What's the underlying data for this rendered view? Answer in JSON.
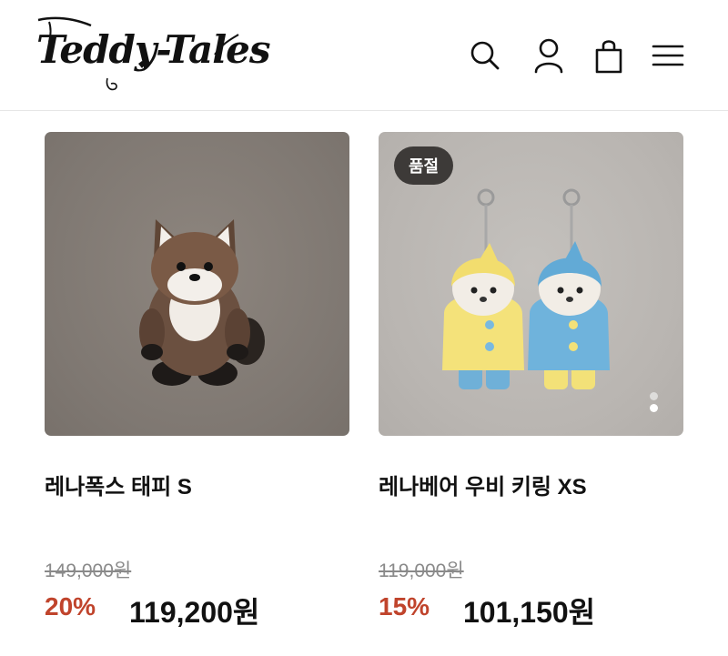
{
  "header": {
    "logo_text": "Teddy-Tales",
    "icons": [
      "search-icon",
      "user-icon",
      "shopping-bag-icon",
      "menu-icon"
    ]
  },
  "products": [
    {
      "name": "레나폭스 태피 S",
      "original_price": "149,000원",
      "discount": "20%",
      "price": "119,200원",
      "sold_out": false
    },
    {
      "name": "레나베어 우비 키링 XS",
      "original_price": "119,000원",
      "discount": "15%",
      "price": "101,150원",
      "sold_out": true,
      "sold_out_label": "품절",
      "carousel": {
        "total": 2,
        "active_index": 1
      }
    }
  ],
  "colors": {
    "discount": "#c0442c",
    "soldout_badge": "#3d3a38"
  }
}
